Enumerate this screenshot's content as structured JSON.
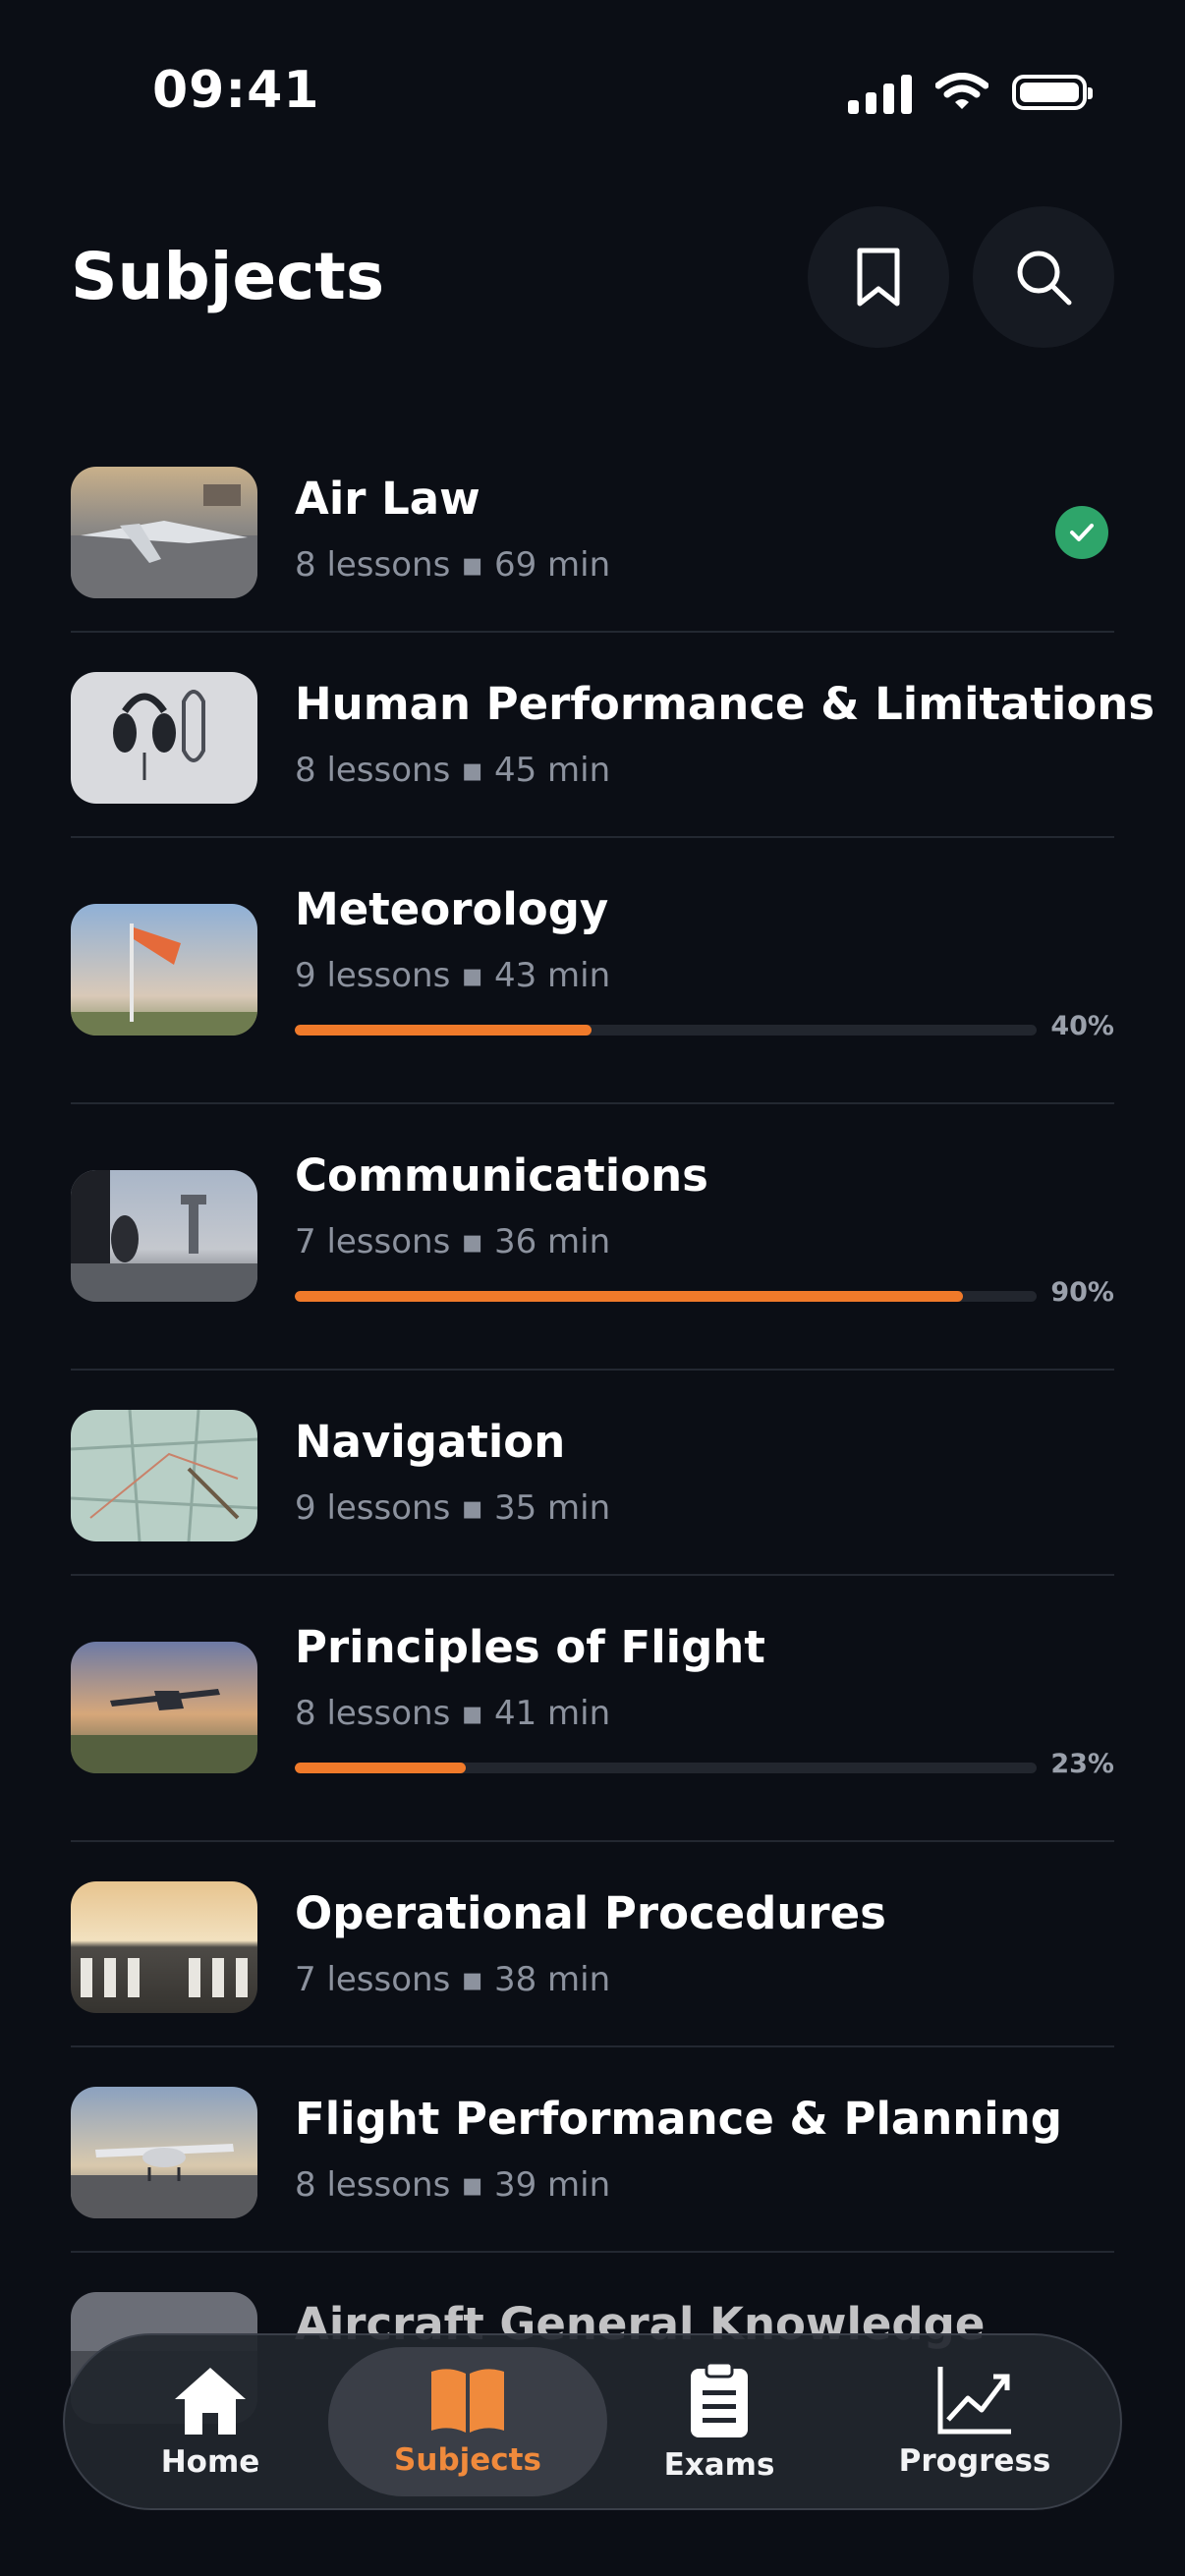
{
  "status_bar": {
    "time": "09:41"
  },
  "header": {
    "title": "Subjects"
  },
  "subjects": [
    {
      "title": "Air Law",
      "meta": "8 lessons ▪ 69 min",
      "completed": true
    },
    {
      "title": "Human Performance & Limitations",
      "meta": "8 lessons ▪ 45 min"
    },
    {
      "title": "Meteorology",
      "meta": "9 lessons ▪ 43 min",
      "progress": 0.4,
      "progress_label": "40%"
    },
    {
      "title": "Communications",
      "meta": "7 lessons ▪ 36 min",
      "progress": 0.9,
      "progress_label": "90%"
    },
    {
      "title": "Navigation",
      "meta": "9 lessons ▪ 35 min"
    },
    {
      "title": "Principles of Flight",
      "meta": "8 lessons ▪ 41 min",
      "progress": 0.23,
      "progress_label": "23%"
    },
    {
      "title": "Operational Procedures",
      "meta": "7 lessons ▪ 38 min"
    },
    {
      "title": "Flight Performance & Planning",
      "meta": "8 lessons ▪ 39 min"
    },
    {
      "title": "Aircraft General Knowledge"
    }
  ],
  "tab_bar": {
    "tabs": [
      {
        "label": "Home",
        "icon": "home-icon"
      },
      {
        "label": "Subjects",
        "icon": "book-icon",
        "active": true
      },
      {
        "label": "Exams",
        "icon": "clipboard-icon"
      },
      {
        "label": "Progress",
        "icon": "chart-icon"
      }
    ]
  },
  "colors": {
    "background": "#0b0e15",
    "accent": "#f07a2a",
    "success": "#2ea56a",
    "muted_text": "#8c929e"
  }
}
